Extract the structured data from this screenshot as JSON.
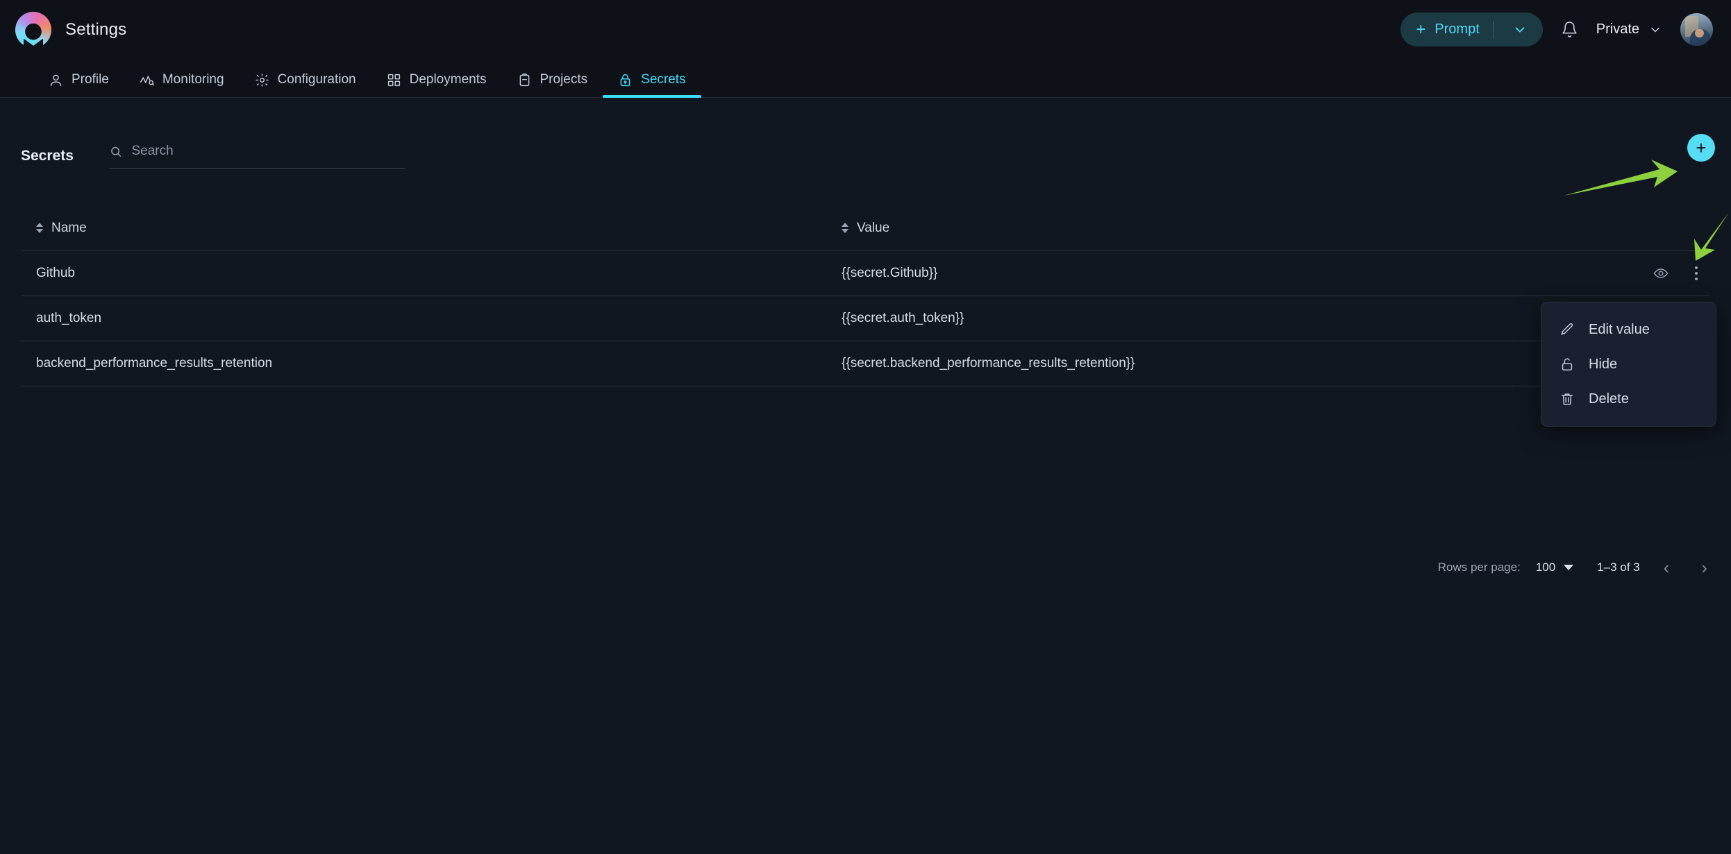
{
  "app": {
    "title": "Settings",
    "logo_icon": "brand-logo-icon"
  },
  "topbar": {
    "prompt_plus": "+",
    "prompt_label": "Prompt",
    "prompt_caret_icon": "chevron-down-icon",
    "bell_icon": "notification-bell-icon",
    "scope_label": "Private",
    "scope_caret_icon": "chevron-down-icon",
    "avatar_icon": "user-avatar"
  },
  "tabs": [
    {
      "label": "Profile",
      "icon": "user-icon",
      "active": false
    },
    {
      "label": "Monitoring",
      "icon": "analytics-icon",
      "active": false
    },
    {
      "label": "Configuration",
      "icon": "gear-icon",
      "active": false
    },
    {
      "label": "Deployments",
      "icon": "grid-icon",
      "active": false
    },
    {
      "label": "Projects",
      "icon": "clipboard-icon",
      "active": false
    },
    {
      "label": "Secrets",
      "icon": "lock-icon",
      "active": true
    }
  ],
  "panel": {
    "title": "Secrets",
    "search": {
      "placeholder": "Search",
      "value": "",
      "icon": "search-icon"
    },
    "add_button": {
      "label": "+",
      "icon": "plus-icon"
    }
  },
  "table": {
    "columns": [
      {
        "key": "name",
        "label": "Name",
        "sort_icon": "sort-icon"
      },
      {
        "key": "value",
        "label": "Value",
        "sort_icon": "sort-icon"
      }
    ],
    "rows": [
      {
        "name": "Github",
        "value": "{{secret.Github}}"
      },
      {
        "name": "auth_token",
        "value": "{{secret.auth_token}}"
      },
      {
        "name": "backend_performance_results_retention",
        "value": "{{secret.backend_performance_results_retention}}"
      }
    ],
    "row_actions": {
      "visibility_icon": "eye-icon",
      "more_icon": "three-dots-vertical-icon"
    }
  },
  "context_menu": {
    "open_for_row": "Github",
    "items": [
      {
        "label": "Edit value",
        "icon": "pencil-icon"
      },
      {
        "label": "Hide",
        "icon": "lock-icon"
      },
      {
        "label": "Delete",
        "icon": "trash-icon"
      }
    ]
  },
  "pagination": {
    "rows_per_page_label": "Rows per page:",
    "rows_per_page_value": "100",
    "rows_per_page_caret_icon": "caret-down-icon",
    "range_label": "1–3 of 3",
    "prev_icon": "chevron-left-icon",
    "next_icon": "chevron-right-icon"
  },
  "annotations": [
    {
      "name": "arrow-to-add-button",
      "color": "#8ed13f",
      "direction": "up-right"
    },
    {
      "name": "arrow-to-row-menu",
      "color": "#8ed13f",
      "direction": "down-left"
    }
  ],
  "colors": {
    "page_bg": "#111720",
    "header_bg": "#0e1118",
    "accent_cyan": "#3ddcf7",
    "add_button": "#56dcf5",
    "menu_bg": "#1a2030",
    "text_primary": "#e9edf4",
    "text_muted": "#9aa4b4",
    "annotation_green": "#8ed13f"
  }
}
